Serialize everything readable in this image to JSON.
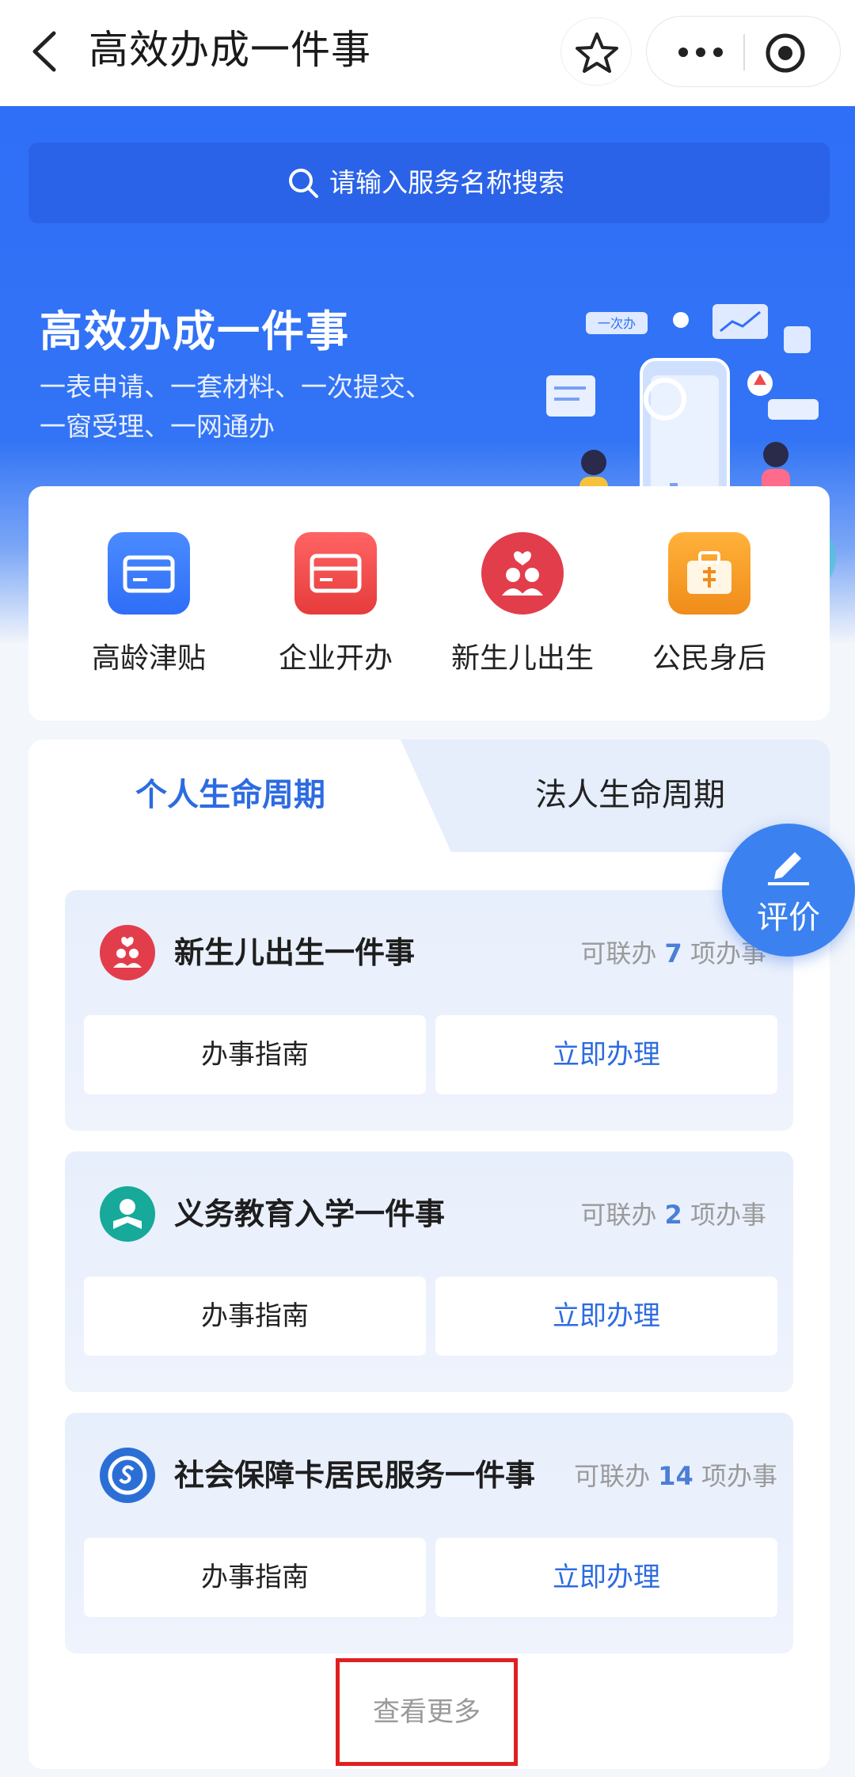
{
  "app": {
    "title": "高效办成一件事"
  },
  "search": {
    "placeholder": "请输入服务名称搜索"
  },
  "hero": {
    "title": "高效办成一件事",
    "subtitle_line1": "一表申请、一套材料、一次提交、",
    "subtitle_line2": "一窗受理、一网通办",
    "illus_badge": "一次办"
  },
  "quick": {
    "items": [
      {
        "label": "高龄津贴",
        "icon": "elder-card-icon",
        "color": "#3a78f0"
      },
      {
        "label": "企业开办",
        "icon": "business-card-icon",
        "color": "#ee4b4b"
      },
      {
        "label": "新生儿出生",
        "icon": "newborn-icon",
        "color": "#e23d4b"
      },
      {
        "label": "公民身后",
        "icon": "briefcase-icon",
        "color": "#f5a623"
      }
    ]
  },
  "tabs": {
    "personal": "个人生命周期",
    "corporate": "法人生命周期"
  },
  "services": [
    {
      "name": "新生儿出生一件事",
      "count_prefix": "可联办",
      "count": "7",
      "count_suffix": "项办事",
      "guide": "办事指南",
      "apply": "立即办理",
      "icon": "newborn-icon",
      "color": "#e23d4b"
    },
    {
      "name": "义务教育入学一件事",
      "count_prefix": "可联办",
      "count": "2",
      "count_suffix": "项办事",
      "guide": "办事指南",
      "apply": "立即办理",
      "icon": "student-icon",
      "color": "#17a99a"
    },
    {
      "name": "社会保障卡居民服务一件事",
      "count_prefix": "可联办",
      "count": "14",
      "count_suffix": "项办事",
      "guide": "办事指南",
      "apply": "立即办理",
      "icon": "social-security-icon",
      "color": "#2b6fd6"
    }
  ],
  "more": {
    "label": "查看更多"
  },
  "rate": {
    "label": "评价"
  }
}
